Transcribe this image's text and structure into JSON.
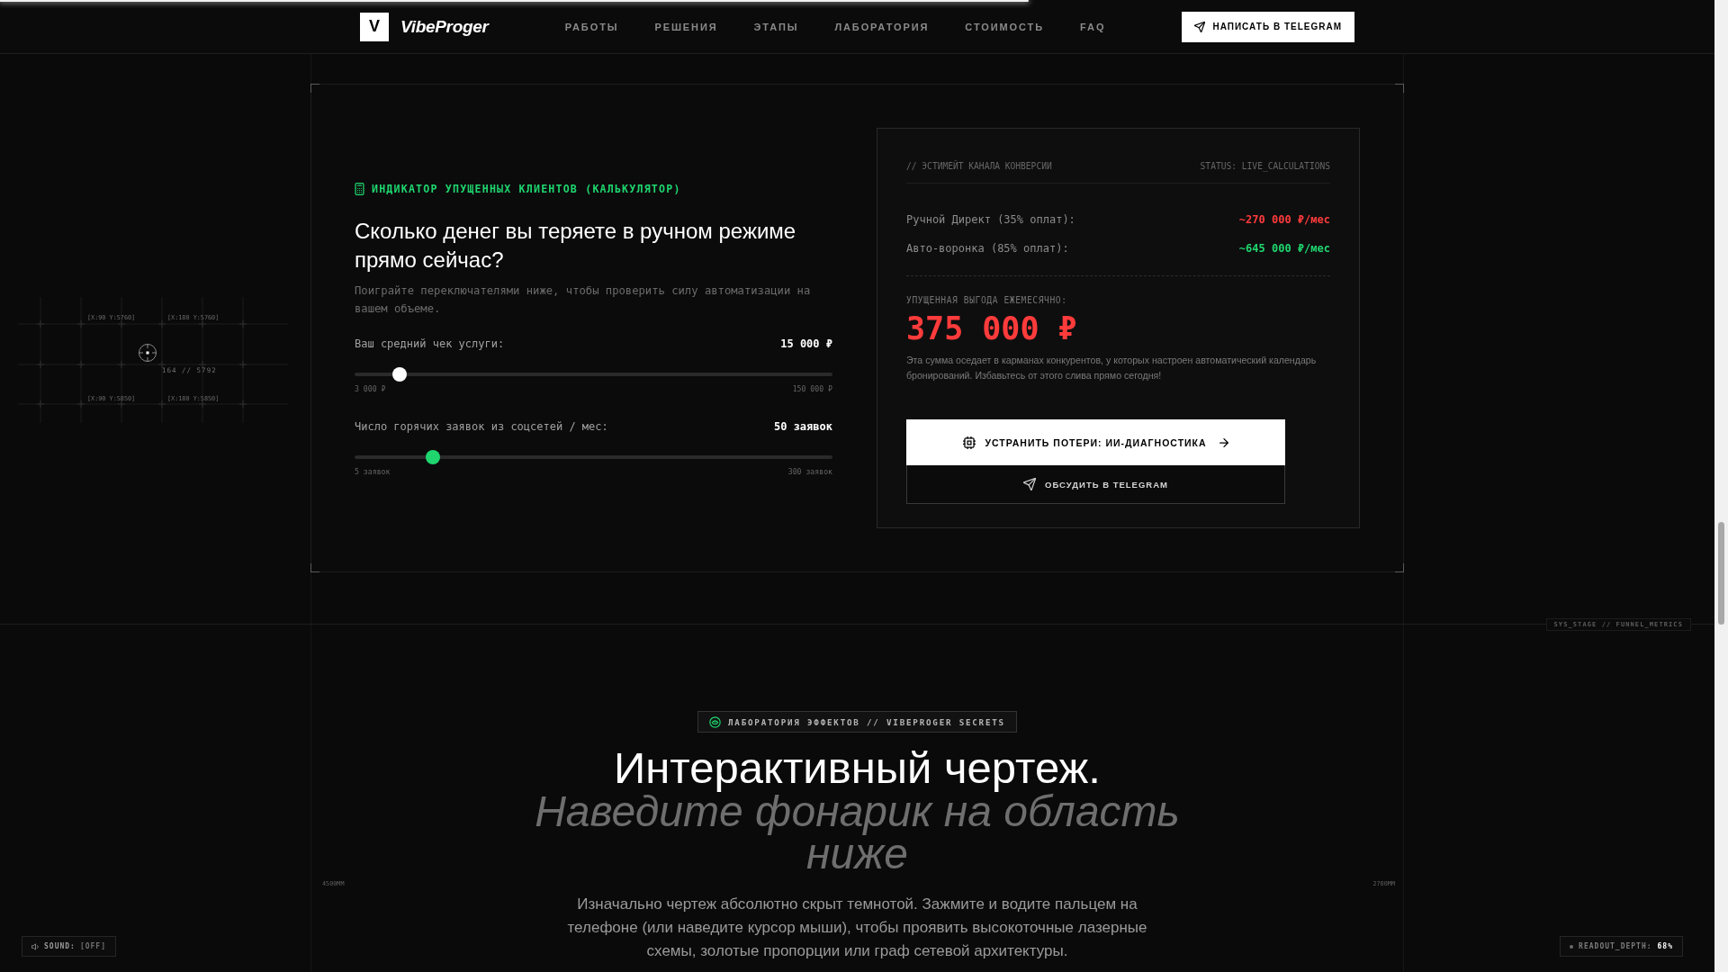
{
  "scroll_progress": {
    "level": 0.6
  },
  "header": {
    "logo": {
      "mark": "V",
      "name": "VibeProger"
    },
    "nav": [
      "РАБОТЫ",
      "РЕШЕНИЯ",
      "ЭТАПЫ",
      "ЛАБОРАТОРИЯ",
      "СТОИМОСТЬ",
      "FAQ"
    ],
    "cta": "НАПИСАТЬ В TELEGRAM"
  },
  "blueprint_marks": {
    "coords": [
      "[X:90 Y:5760]",
      "[X:180 Y:5760]",
      "[X:90 Y:5850]",
      "[X:180 Y:5850]"
    ],
    "cursor": "164 // 5792"
  },
  "calculator": {
    "eyebrow": "ИНДИКАТОР УПУЩЕННЫХ КЛИЕНТОВ (КАЛЬКУЛЯТОР)",
    "title": "Сколько денег вы теряете в ручном режиме прямо сейчас?",
    "description": "Поиграйте переключателями ниже, чтобы проверить силу автоматизации на вашем объеме.",
    "sliders": [
      {
        "label": "Ваш средний чек услуги:",
        "value": "15 000 ₽",
        "level": 0.082,
        "color": "#ffffff",
        "min": "3 000 ₽",
        "max": "150 000 ₽"
      },
      {
        "label": "Число горячих заявок из соцсетей / мес:",
        "value": "50 заявок",
        "level": 0.153,
        "color": "#1fd66e",
        "min": "5 заявок",
        "max": "300 заявок"
      }
    ]
  },
  "estimate": {
    "caption": "// ЭСТИМЕЙТ КАНАЛА КОНВЕРСИИ",
    "status": "STATUS: LIVE_CALCULATIONS",
    "rows": [
      {
        "label": "Ручной Директ (35% оплат):",
        "value": "~270 000 ₽/мес",
        "color": "#ff3b3b"
      },
      {
        "label": "Авто-воронка (85% оплат):",
        "value": "~645 000 ₽/мес",
        "color": "#1fd66e"
      }
    ],
    "loss_label": "УПУЩЕННАЯ ВЫГОДА ЕЖЕМЕСЯЧНО:",
    "loss_value": "375 000 ₽",
    "note": "Эта сумма оседает в карманах конкурентов, у которых настроен автоматический календарь бронирований. Избавьтесь от этого слива прямо сегодня!",
    "buttons": [
      {
        "kind": "primary",
        "label": "УСТРАНИТЬ ПОТЕРИ: ИИ-ДИАГНОСТИКА"
      },
      {
        "kind": "secondary",
        "label": "ОБСУДИТЬ В TELEGRAM"
      }
    ]
  },
  "stage_tag": "SYS_STAGE // FUNNEL_METRICS",
  "rulers": [
    "4500MM",
    "2700MM"
  ],
  "lab": {
    "badge": "ЛАБОРАТОРИЯ ЭФФЕКТОВ // VIBEPROGER SECRETS",
    "title": "Интерактивный чертеж.",
    "subtitle": "Наведите фонарик на область ниже",
    "text": "Изначально чертеж абсолютно скрыт темнотой. Зажмите и водите пальцем на телефоне (или наведите курсор мыши), чтобы проявить высокоточные лазерные схемы, золотые пропорции или граф сетевой архитектуры."
  },
  "sound_toggle": {
    "label": "SOUND:",
    "value": "[OFF]"
  },
  "readout": {
    "label": "READOUT_DEPTH:",
    "value": "68%"
  }
}
